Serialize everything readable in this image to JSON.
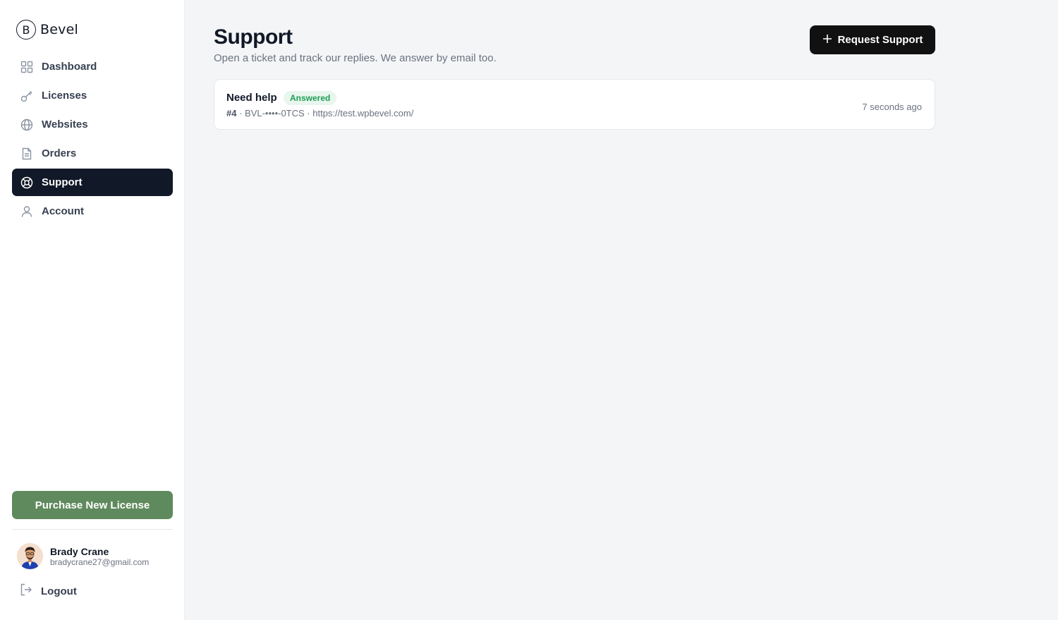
{
  "brand": {
    "mark": "B",
    "name": "Bevel"
  },
  "sidebar": {
    "items": [
      {
        "label": "Dashboard",
        "icon": "grid-icon",
        "active": false
      },
      {
        "label": "Licenses",
        "icon": "key-icon",
        "active": false
      },
      {
        "label": "Websites",
        "icon": "globe-icon",
        "active": false
      },
      {
        "label": "Orders",
        "icon": "document-icon",
        "active": false
      },
      {
        "label": "Support",
        "icon": "lifebuoy-icon",
        "active": true
      },
      {
        "label": "Account",
        "icon": "user-icon",
        "active": false
      }
    ],
    "purchase_label": "Purchase New License",
    "user": {
      "name": "Brady Crane",
      "email": "bradycrane27@gmail.com"
    },
    "logout_label": "Logout"
  },
  "main": {
    "title": "Support",
    "subtitle": "Open a ticket and track our replies. We answer by email too.",
    "request_button": "Request Support",
    "tickets": [
      {
        "title": "Need help",
        "status": "Answered",
        "number": "#4",
        "meta": " · BVL-••••-0TCS · https://test.wpbevel.com/",
        "time": "7 seconds ago"
      }
    ]
  },
  "colors": {
    "active_nav": "#111827",
    "purchase_button": "#5f8a5d",
    "badge_bg": "#e8f6ee",
    "badge_text": "#1f9d55",
    "page_bg": "#f4f5f7"
  }
}
